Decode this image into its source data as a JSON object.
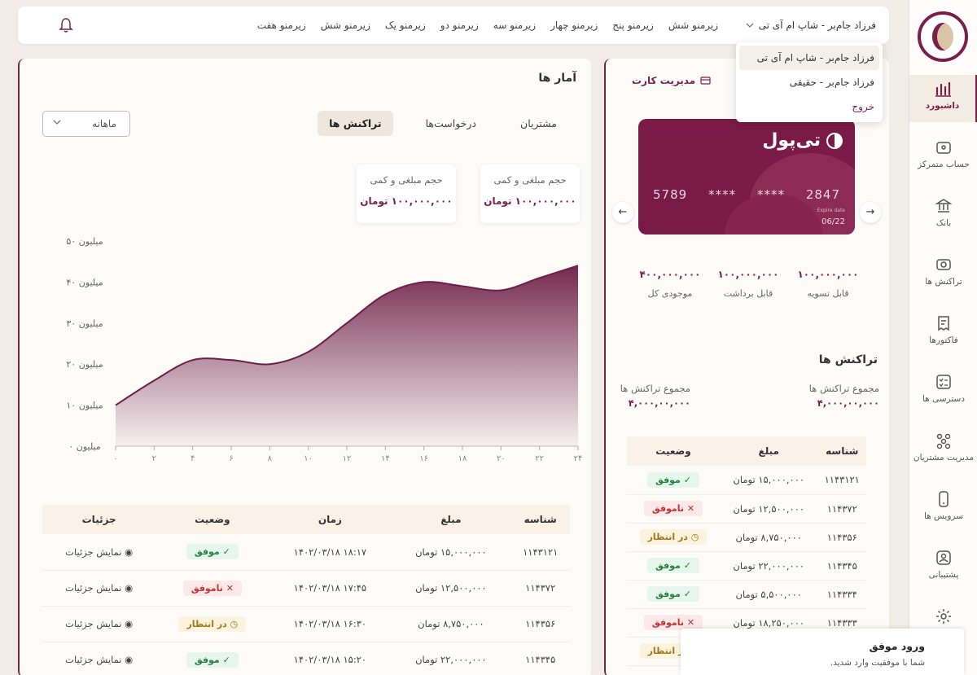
{
  "colors": {
    "brand": "#7a1f4a",
    "background": "#f1ede6",
    "success": "#25803e",
    "fail": "#c03434",
    "pending": "#a07818"
  },
  "sidebar": {
    "items": [
      {
        "label": "داشبورد",
        "icon": "bar-chart-icon",
        "active": true
      },
      {
        "label": "حساب متمرکز",
        "icon": "wallet-icon"
      },
      {
        "label": "بانک",
        "icon": "bank-icon"
      },
      {
        "label": "تراکنش ها",
        "icon": "transactions-icon"
      },
      {
        "label": "فاکتورها",
        "icon": "invoice-icon"
      },
      {
        "label": "دسترسی ها",
        "icon": "checklist-icon"
      },
      {
        "label": "مدیریت مشتریان",
        "icon": "customers-icon"
      },
      {
        "label": "سرویس ها",
        "icon": "mobile-icon"
      },
      {
        "label": "پشتیبانی",
        "icon": "support-icon"
      },
      {
        "label": "",
        "icon": "gear-icon"
      }
    ]
  },
  "topbar": {
    "account": "فرزاد جام‌بر - شاپ ام آی تی",
    "nav": [
      "زیرمنو شش",
      "زیرمنو پنج",
      "زیرمنو چهار",
      "زیرمنو سه",
      "زیرمنو دو",
      "زیرمنو یک",
      "زیرمنو شش",
      "زیرمنو هفت"
    ]
  },
  "dropdown": {
    "items": [
      "فرزاد جام‌بر - شاپ ام آی تی",
      "فرزاد جام‌بر - حقیقی"
    ],
    "logout": "خروج"
  },
  "stats": {
    "title": "آمار ها",
    "tabs": [
      "تراکنش ها",
      "درخواست‌ها",
      "مشتریان"
    ],
    "period": "ماهانه",
    "cards": [
      {
        "title": "حجم مبلغی و کمی",
        "value": "۱۰۰,۰۰۰,۰۰۰ تومان"
      },
      {
        "title": "حجم مبلغی و کمی",
        "value": "۱۰۰,۰۰۰,۰۰۰ تومان"
      }
    ]
  },
  "chart_data": {
    "type": "area",
    "x": [
      0,
      2,
      4,
      6,
      8,
      10,
      12,
      14,
      16,
      18,
      20,
      22,
      24
    ],
    "x_tick_labels": [
      "۰",
      "۲",
      "۴",
      "۶",
      "۸",
      "۱۰",
      "۱۲",
      "۱۴",
      "۱۶",
      "۱۸",
      "۲۰",
      "۲۲",
      "۲۴"
    ],
    "y_tick_labels": [
      "۰ میلیون",
      "۱۰ میلیون",
      "۲۰ میلیون",
      "۳۰ میلیون",
      "۴۰ میلیون",
      "۵۰ میلیون"
    ],
    "ylim": [
      0,
      50
    ],
    "series": [
      {
        "values": [
          10,
          16,
          21,
          21,
          20,
          23,
          30,
          37,
          40,
          39,
          38,
          41,
          44
        ]
      }
    ]
  },
  "main_table": {
    "headers": [
      "شناسه",
      "مبلغ",
      "زمان",
      "وضعیت",
      "جزئیات"
    ],
    "detail_label": "نمایش جزئیات",
    "rows": [
      {
        "id": "۱۱۴۳۱۲۱",
        "amount": "۱۵,۰۰۰,۰۰۰ تومان",
        "time": "۱۸:۱۷ ۱۴۰۲/۰۳/۱۸",
        "status": "موفق",
        "kind": "ok"
      },
      {
        "id": "۱۱۴۳۷۲",
        "amount": "۱۲,۵۰۰,۰۰۰ تومان",
        "time": "۱۷:۴۵ ۱۴۰۲/۰۳/۱۸",
        "status": "ناموفق",
        "kind": "fail"
      },
      {
        "id": "۱۱۴۳۵۶",
        "amount": "۸,۷۵۰,۰۰۰ تومان",
        "time": "۱۶:۳۰ ۱۴۰۲/۰۳/۱۸",
        "status": "در انتظار",
        "kind": "pend"
      },
      {
        "id": "۱۱۴۳۴۵",
        "amount": "۲۲,۰۰۰,۰۰۰ تومان",
        "time": "۱۵:۲۰ ۱۴۰۲/۰۳/۱۸",
        "status": "موفق",
        "kind": "ok"
      }
    ]
  },
  "card_panel": {
    "manage_label": "مدیریت کارت",
    "brand": "تی‌پول",
    "number": [
      "5789",
      "****",
      "****",
      "2847"
    ],
    "expiry_label": "Expire date",
    "expiry": "06/22",
    "balances": [
      {
        "label": "قابل تسویه",
        "value": "۱۰۰,۰۰۰,۰۰۰"
      },
      {
        "label": "قابل برداشت",
        "value": "۱۰۰,۰۰۰,۰۰۰"
      },
      {
        "label": "موجودی کل",
        "value": "۴۰۰,۰۰۰,۰۰۰"
      }
    ]
  },
  "transactions": {
    "title": "تراکنش ها",
    "summary": [
      {
        "label": "مجموع تراکنش ها",
        "value": "۴,۰۰۰,۰۰,۰۰۰"
      },
      {
        "label": "مجموع تراکنش ها",
        "value": "۴,۰۰۰,۰۰,۰۰۰"
      }
    ],
    "headers": [
      "شناسه",
      "مبلغ",
      "وضعیت"
    ],
    "rows": [
      {
        "id": "۱۱۴۳۱۲۱",
        "amount": "۱۵,۰۰۰,۰۰۰ تومان",
        "status": "موفق",
        "kind": "ok"
      },
      {
        "id": "۱۱۴۳۷۲",
        "amount": "۱۲,۵۰۰,۰۰۰ تومان",
        "status": "ناموفق",
        "kind": "fail"
      },
      {
        "id": "۱۱۴۳۵۶",
        "amount": "۸,۷۵۰,۰۰۰ تومان",
        "status": "در انتظار",
        "kind": "pend"
      },
      {
        "id": "۱۱۴۳۴۵",
        "amount": "۲۲,۰۰۰,۰۰۰ تومان",
        "status": "موفق",
        "kind": "ok"
      },
      {
        "id": "۱۱۴۳۳۴",
        "amount": "۵,۵۰۰,۰۰۰ تومان",
        "status": "موفق",
        "kind": "ok"
      },
      {
        "id": "۱۱۴۳۳۳",
        "amount": "۱۸,۲۵۰,۰۰۰ تومان",
        "status": "ناموفق",
        "kind": "fail"
      },
      {
        "id": "",
        "amount": "",
        "status": "در انتظار",
        "kind": "pend"
      }
    ]
  },
  "toast": {
    "title": "ورود موفق",
    "message": "شما با موفقیت وارد شدید."
  }
}
